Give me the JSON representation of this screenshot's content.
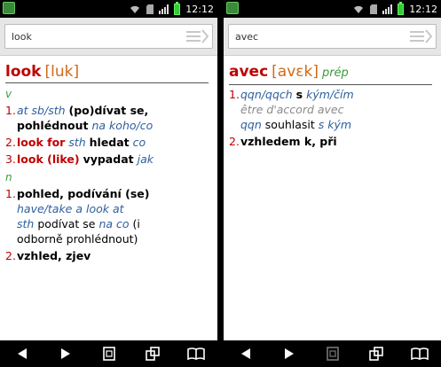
{
  "left": {
    "status": {
      "time": "12:12"
    },
    "search": {
      "value": "look"
    },
    "entry": {
      "headword": "look",
      "pron": "[luk]",
      "pos1": "v",
      "senses_v": [
        {
          "num": "1.",
          "a": "at sb/sth",
          "b": "(po)dívat se,",
          "c": "pohlédnout",
          "d": "na koho/co"
        },
        {
          "num": "2.",
          "a": "look for",
          "b": "sth",
          "c": "hledat",
          "d": "co"
        },
        {
          "num": "3.",
          "a": "look (like)",
          "b": "vypadat",
          "c": "jak"
        }
      ],
      "pos2": "n",
      "senses_n": [
        {
          "num": "1.",
          "a": "pohled, podívání (se)",
          "b": "have/take a look at",
          "c": "sth",
          "d": "podívat se",
          "e": "na co",
          "f": "(i",
          "g": "odborně prohlédnout)"
        },
        {
          "num": "2.",
          "a": "vzhled, zjev"
        }
      ]
    }
  },
  "right": {
    "status": {
      "time": "12:12"
    },
    "search": {
      "value": "avec"
    },
    "entry": {
      "headword": "avec",
      "pron": "[avɛk]",
      "pos": "prép",
      "senses": [
        {
          "num": "1.",
          "a": "qqn/qqch",
          "b": "s",
          "c": "kým/čím",
          "d": "être d'accord avec",
          "e": "qqn",
          "f": "souhlasit",
          "g": "s kým"
        },
        {
          "num": "2.",
          "a": "vzhledem k, při"
        }
      ]
    }
  },
  "icons": {
    "back": "back-arrow-icon",
    "forward": "forward-arrow-icon",
    "window_single": "single-window-icon",
    "window_multi": "multi-window-icon",
    "bookmarks": "book-icon"
  }
}
